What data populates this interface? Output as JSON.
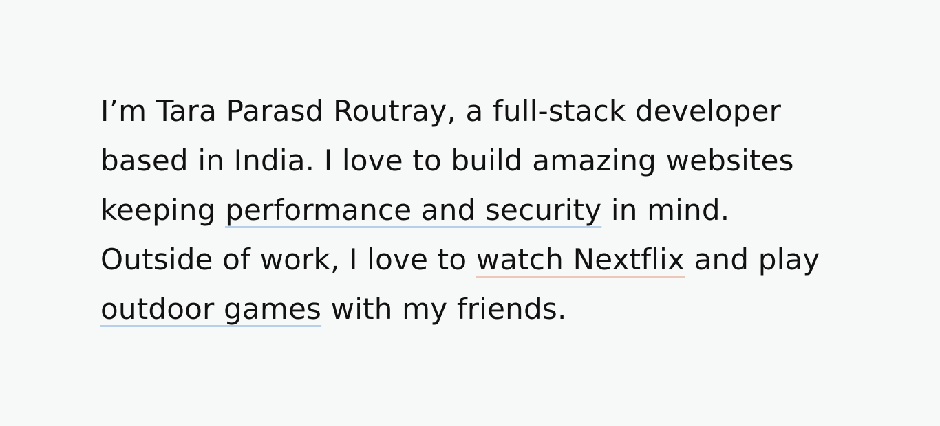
{
  "bio": {
    "line1": "I’m Tara Parasd Routray, a full-stack developer",
    "line2": "based in India. I love to build amazing websites",
    "line3_before": "keeping ",
    "line3_highlight": "performance and security",
    "line3_after": " in mind.",
    "line4_before": "Outside of work, I love to ",
    "line4_highlight": "watch Nextflix",
    "line4_after": " and play",
    "line5_highlight": "outdoor games",
    "line5_after": " with my friends."
  },
  "colors": {
    "background": "#f7f8f8",
    "text": "#111111",
    "highlight_blue": "#b7cfe8",
    "highlight_peach": "#ecc8b8"
  }
}
